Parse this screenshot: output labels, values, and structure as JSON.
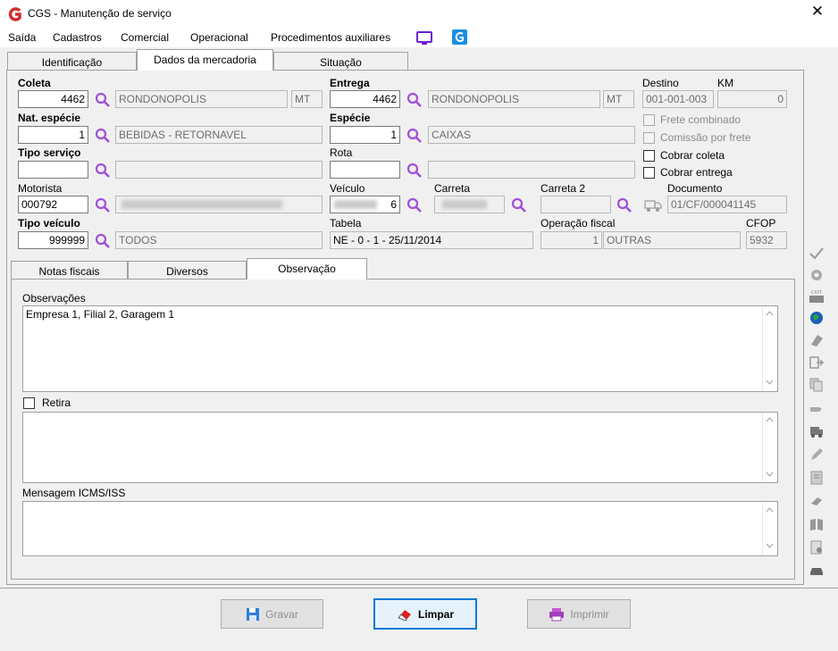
{
  "window": {
    "title": "CGS - Manutenção de serviço",
    "close_glyph": "✕"
  },
  "menu": {
    "items": [
      "Saída",
      "Cadastros",
      "Comercial",
      "Operacional",
      "Procedimentos auxiliares"
    ]
  },
  "top_tabs": [
    "Identificação",
    "Dados da mercadoria",
    "Situação"
  ],
  "form": {
    "coleta": {
      "label": "Coleta",
      "code": "4462",
      "city": "RONDONOPOLIS",
      "uf": "MT"
    },
    "entrega": {
      "label": "Entrega",
      "code": "4462",
      "city": "RONDONOPOLIS",
      "uf": "MT"
    },
    "destino": {
      "label": "Destino",
      "value": "001-001-003"
    },
    "km": {
      "label": "KM",
      "value": "0"
    },
    "nat_especie": {
      "label": "Nat. espécie",
      "code": "1",
      "desc": "BEBIDAS - RETORNAVEL"
    },
    "especie": {
      "label": "Espécie",
      "code": "1",
      "desc": "CAIXAS"
    },
    "frete_combinado": "Frete combinado",
    "comissao_frete": "Comissão por frete",
    "cobrar_coleta": "Cobrar coleta",
    "cobrar_entrega": "Cobrar entrega",
    "tipo_servico": {
      "label": "Tipo serviço",
      "code": "",
      "desc": ""
    },
    "rota": {
      "label": "Rota",
      "code": "",
      "desc": ""
    },
    "motorista": {
      "label": "Motorista",
      "code": "000792"
    },
    "veiculo": {
      "label": "Veículo",
      "value": "6"
    },
    "carreta": {
      "label": "Carreta"
    },
    "carreta2": {
      "label": "Carreta 2",
      "value": ""
    },
    "documento": {
      "label": "Documento",
      "value": "01/CF/000041145"
    },
    "tipo_veiculo": {
      "label": "Tipo veículo",
      "code": "999999",
      "desc": "TODOS"
    },
    "tabela": {
      "label": "Tabela",
      "value": "NE - 0 - 1 - 25/11/2014"
    },
    "operacao_fiscal": {
      "label": "Operação fiscal",
      "code": "1",
      "desc": "OUTRAS"
    },
    "cfop": {
      "label": "CFOP",
      "value": "5932"
    }
  },
  "sub_tabs": [
    "Notas fiscais",
    "Diversos",
    "Observação"
  ],
  "obs": {
    "label": "Observações",
    "text": "Empresa 1, Filial 2, Garagem 1",
    "retira_label": "Retira",
    "retira_text": "",
    "icms_label": "Mensagem ICMS/ISS",
    "icms_text": ""
  },
  "buttons": {
    "gravar": "Gravar",
    "limpar": "Limpar",
    "imprimir": "Imprimir"
  },
  "colors": {
    "accent": "#0078d7",
    "search": "#a14fd9",
    "logo": "#d32f2f"
  }
}
